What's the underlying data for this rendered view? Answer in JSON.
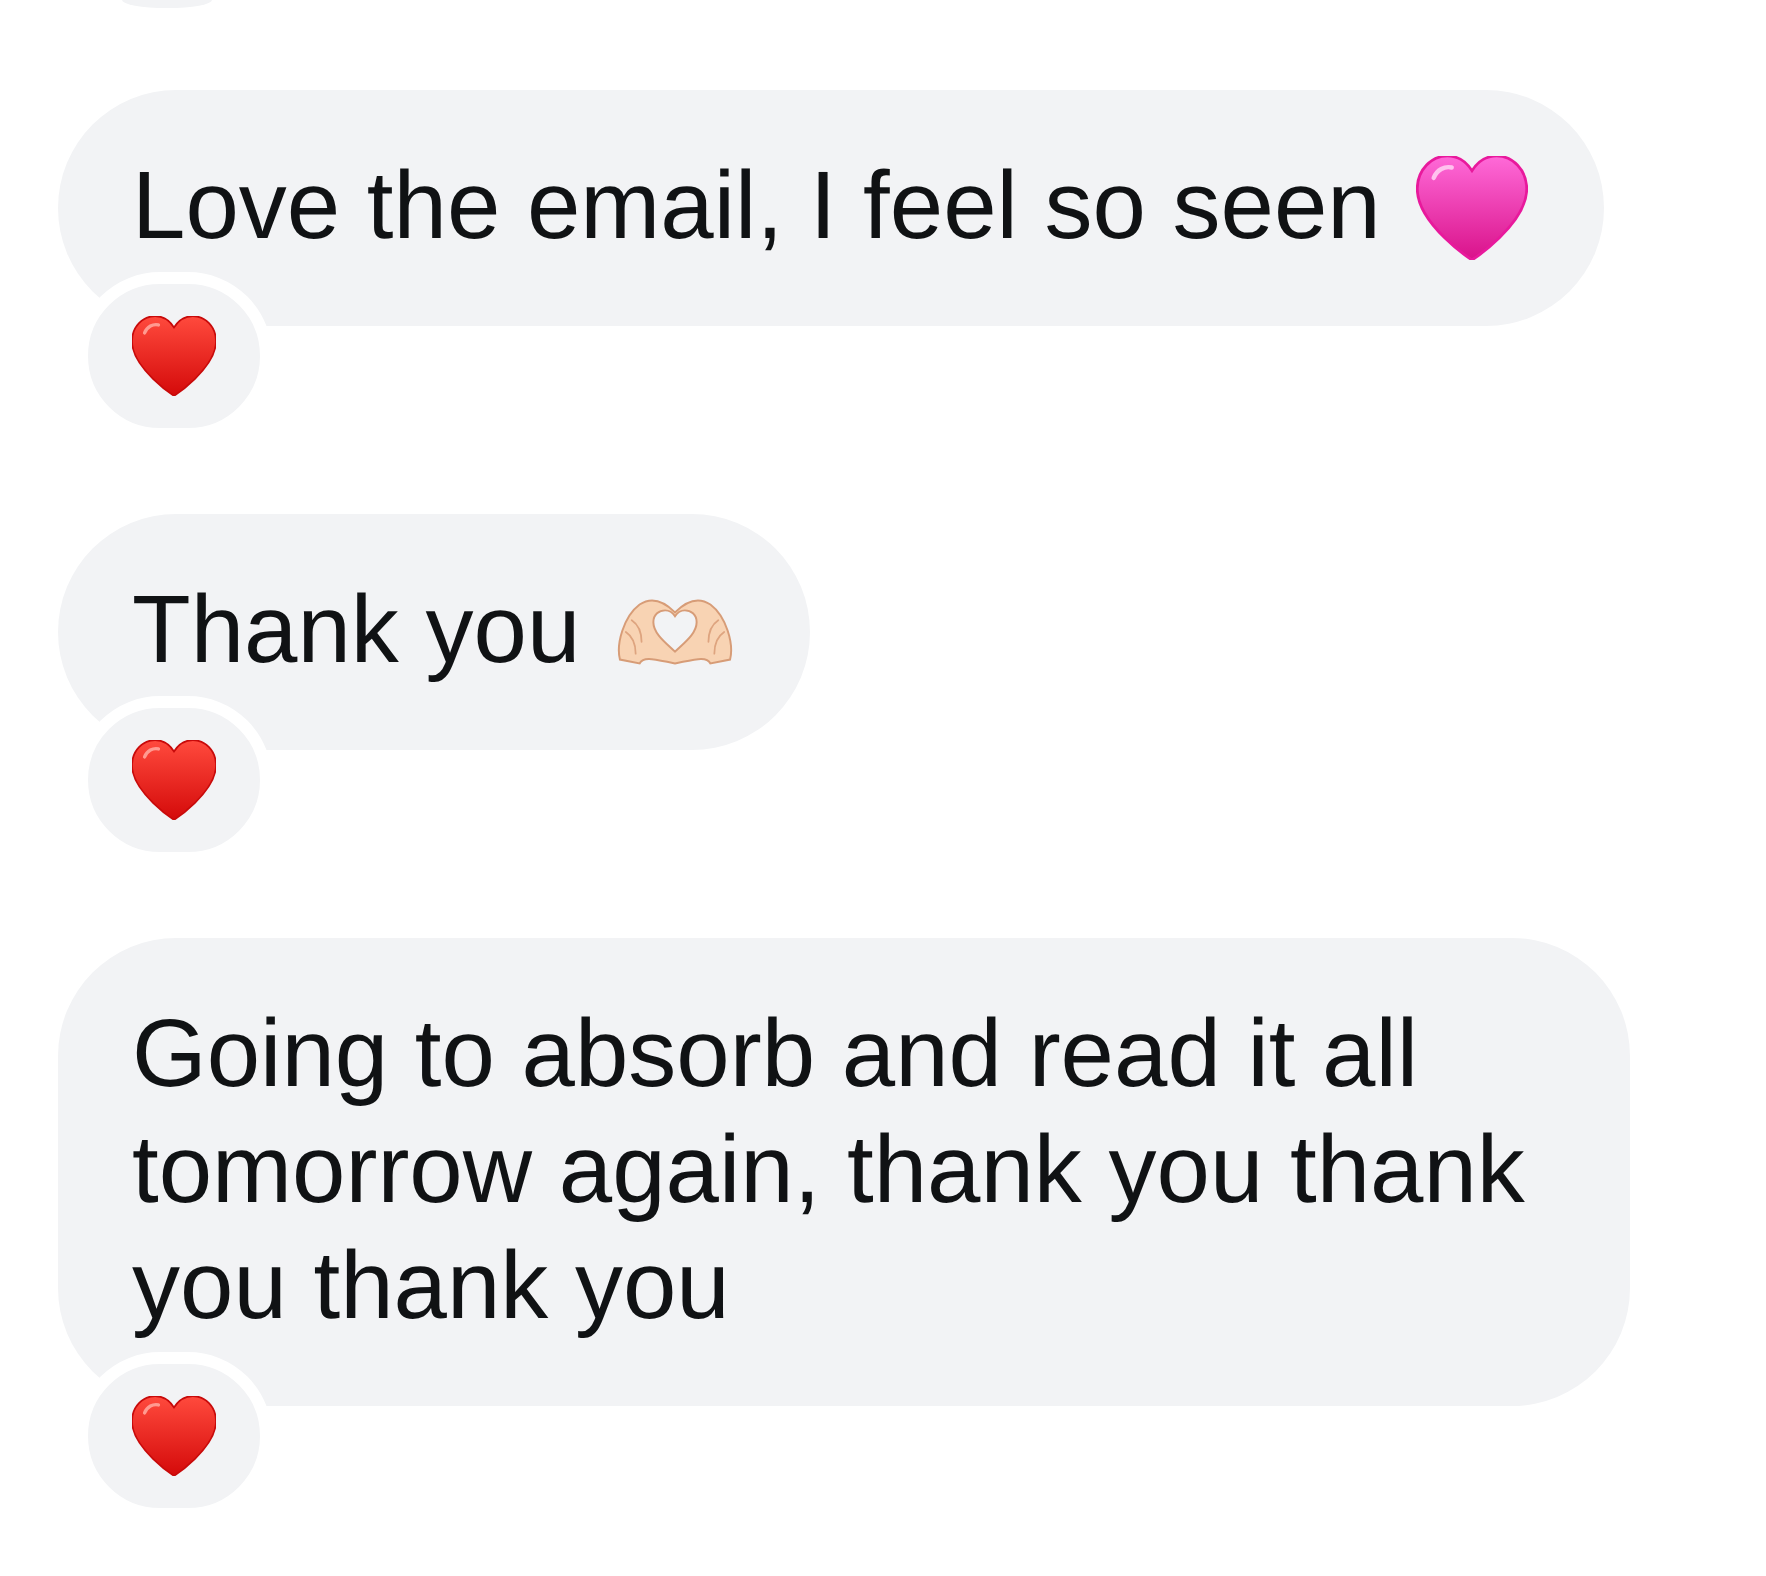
{
  "previous_reaction_edge": true,
  "messages": [
    {
      "text": "Love the email, I feel so seen",
      "emoji": {
        "kind": "pink_heart"
      },
      "reaction": {
        "kind": "heart"
      }
    },
    {
      "text": "Thank you",
      "emoji": {
        "kind": "heart_hands"
      },
      "reaction": {
        "kind": "heart"
      }
    },
    {
      "text": "Going to absorb and read it all tomorrow again, thank you thank you thank you",
      "reaction": {
        "kind": "heart"
      }
    }
  ]
}
